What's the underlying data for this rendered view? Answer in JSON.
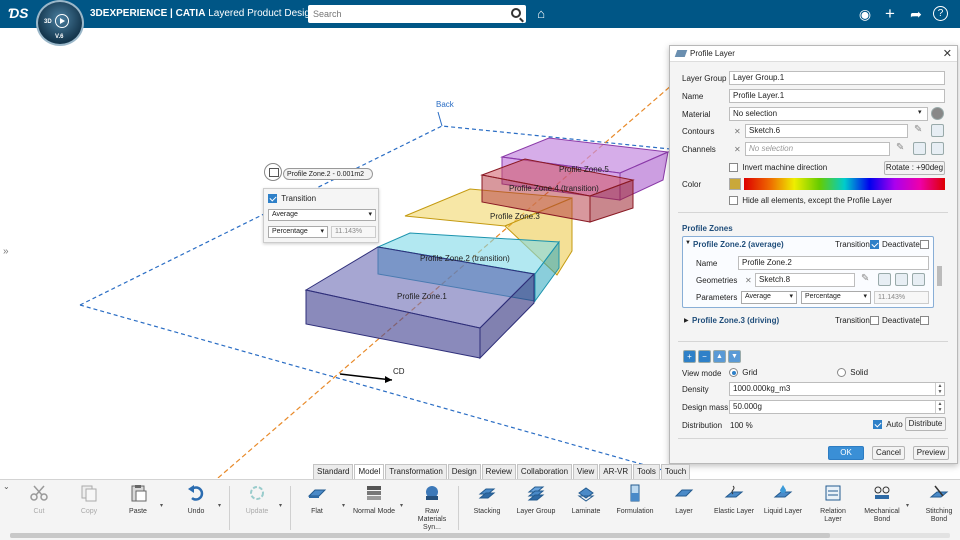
{
  "topbar": {
    "app_brand": "3DEXPERIENCE | CATIA",
    "app_subtitle": "Layered Product Design",
    "compass_3d": "3D",
    "compass_version": "V.6",
    "search_placeholder": "Search"
  },
  "viewport": {
    "labels": {
      "back": "Back",
      "cd": "CD",
      "zone1": "Profile Zone.1",
      "zone2": "Profile Zone.2 (transition)",
      "zone3": "Profile Zone.3",
      "zone4": "Profile Zone.4 (transition)",
      "zone5": "Profile Zone.5"
    },
    "tooltip": "Profile Zone.2 - 0.001m2",
    "mini_panel": {
      "transition_label": "Transition",
      "transition_checked": true,
      "mode": "Average",
      "unit": "Percentage",
      "value": "11.143%"
    }
  },
  "dialog": {
    "title": "Profile Layer",
    "layer_group_label": "Layer Group",
    "layer_group_value": "Layer Group.1",
    "name_label": "Name",
    "name_value": "Profile Layer.1",
    "material_label": "Material",
    "material_value": "No selection",
    "contours_label": "Contours",
    "contours_value": "Sketch.6",
    "channels_label": "Channels",
    "channels_placeholder": "No selection",
    "invert_label": "Invert machine direction",
    "rotate_label": "Rotate : +90deg",
    "color_label": "Color",
    "hide_label": "Hide all elements, except the Profile Layer",
    "zones_header": "Profile Zones",
    "zone2": {
      "title": "Profile Zone.2 (average)",
      "transition_label": "Transition",
      "deactivate_label": "Deactivate",
      "name_label": "Name",
      "name_value": "Profile Zone.2",
      "geometries_label": "Geometries",
      "geometries_value": "Sketch.8",
      "parameters_label": "Parameters",
      "param_mode": "Average",
      "param_unit": "Percentage",
      "param_value": "11.143%"
    },
    "zone3": {
      "title": "Profile Zone.3 (driving)",
      "transition_label": "Transition",
      "deactivate_label": "Deactivate"
    },
    "view_mode_label": "View mode",
    "view_grid": "Grid",
    "view_solid": "Solid",
    "density_label": "Density",
    "density_value": "1000.000kg_m3",
    "design_mass_label": "Design mass",
    "design_mass_value": "50.000g",
    "distribution_label": "Distribution",
    "distribution_value": "100 %",
    "auto_label": "Auto",
    "distribute_label": "Distribute",
    "ok_label": "OK",
    "cancel_label": "Cancel",
    "preview_label": "Preview"
  },
  "tabs": [
    "Standard",
    "Model",
    "Transformation",
    "Design",
    "Review",
    "Collaboration",
    "View",
    "AR-VR",
    "Tools",
    "Touch"
  ],
  "active_tab": "Model",
  "ribbon": {
    "cut": "Cut",
    "copy": "Copy",
    "paste": "Paste",
    "undo": "Undo",
    "update": "Update",
    "flat": "Flat",
    "normal_mode": "Normal Mode",
    "raw_materials": "Raw Materials Syn...",
    "stacking": "Stacking",
    "layer_group": "Layer Group",
    "laminate": "Laminate",
    "formulation": "Formulation",
    "layer": "Layer",
    "elastic_layer": "Elastic Layer",
    "liquid_layer": "Liquid Layer",
    "relation_layer": "Relation Layer",
    "mechanical_bond": "Mechanical Bond",
    "stitching_bond": "Stitching Bond"
  },
  "colors": {
    "topbar": "#005686",
    "zone1": "#4b4b96",
    "zone2": "#38b8d0",
    "zone3": "#e9c22e",
    "zone4": "#b2313c",
    "zone5": "#b45cd6",
    "accent": "#3a8fd6"
  }
}
